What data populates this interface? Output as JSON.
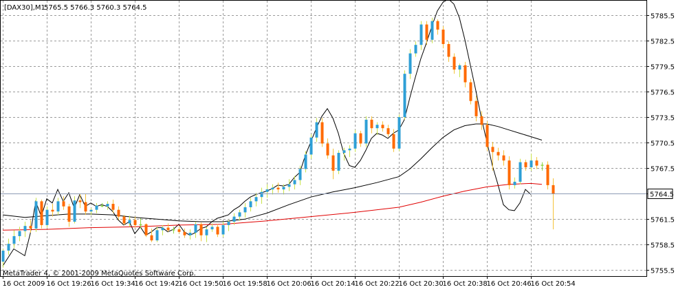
{
  "window": {
    "symbol_label": "[DAX30],M1",
    "ohlc_label": "5765.5 5766.3 5760.3 5764.5",
    "copyright": "MetaTrader 4, © 2001-2009 MetaQuotes Software Corp.",
    "current_price_label": "5764.5"
  },
  "colors": {
    "background": "#ffffff",
    "grid": "#9a9a9a",
    "bull_candle": "#2e9fd6",
    "bear_candle": "#ff6a00",
    "doji": "#8fd642",
    "wick_bull": "#c8e34a",
    "wick_bear": "#f5c23a",
    "fast_ma": "#000000",
    "slow_ma": "#000000",
    "long_ma": "#e00000",
    "price_line": "#8d9bb5"
  },
  "chart_data": {
    "type": "candlestick",
    "ylim": [
      5754.8,
      5787.2
    ],
    "y_ticks": [
      5785.5,
      5782.5,
      5779.5,
      5776.5,
      5773.5,
      5770.5,
      5767.5,
      5764.5,
      5761.5,
      5758.5,
      5755.5
    ],
    "y_tick_labels": [
      "5785.5",
      "5782.5",
      "5779.5",
      "5776.5",
      "5773.5",
      "5770.5",
      "5767.5",
      "5764.5",
      "5761.5",
      "5758.5",
      "5755.5"
    ],
    "x_tick_labels": [
      "16 Oct 2009",
      "16 Oct 19:26",
      "16 Oct 19:34",
      "16 Oct 19:42",
      "16 Oct 19:50",
      "16 Oct 19:58",
      "16 Oct 20:06",
      "16 Oct 20:14",
      "16 Oct 20:22",
      "16 Oct 20:30",
      "16 Oct 20:38",
      "16 Oct 20:46",
      "16 Oct 20:54"
    ],
    "x_tick_bars": [
      0,
      8,
      16,
      24,
      32,
      40,
      48,
      56,
      64,
      72,
      80,
      88,
      96
    ],
    "bar_count": 102,
    "current_price": 5764.5,
    "candles": [
      [
        5756.5,
        5758.0,
        5755.8,
        5757.8
      ],
      [
        5757.8,
        5759.2,
        5757.3,
        5758.6
      ],
      [
        5758.6,
        5760.2,
        5758.1,
        5759.5
      ],
      [
        5759.5,
        5760.6,
        5758.9,
        5760.1
      ],
      [
        5760.1,
        5761.2,
        5759.4,
        5760.7
      ],
      [
        5760.7,
        5761.4,
        5759.9,
        5760.4
      ],
      [
        5760.4,
        5764.0,
        5760.0,
        5763.6
      ],
      [
        5763.6,
        5763.8,
        5760.4,
        5760.8
      ],
      [
        5760.8,
        5763.0,
        5760.5,
        5762.6
      ],
      [
        5762.6,
        5763.3,
        5761.8,
        5762.4
      ],
      [
        5762.4,
        5764.0,
        5762.0,
        5763.6
      ],
      [
        5763.6,
        5764.2,
        5762.6,
        5763.0
      ],
      [
        5763.0,
        5763.3,
        5760.6,
        5761.2
      ],
      [
        5761.2,
        5764.2,
        5761.0,
        5763.7
      ],
      [
        5763.7,
        5764.5,
        5762.8,
        5763.5
      ],
      [
        5763.5,
        5764.5,
        5762.0,
        5762.4
      ],
      [
        5762.4,
        5762.8,
        5762.0,
        5762.6
      ],
      [
        5762.6,
        5763.4,
        5762.2,
        5763.1
      ],
      [
        5763.1,
        5763.4,
        5762.9,
        5763.0
      ],
      [
        5763.0,
        5763.6,
        5762.6,
        5763.3
      ],
      [
        5763.3,
        5763.8,
        5762.2,
        5762.6
      ],
      [
        5762.6,
        5763.0,
        5761.4,
        5761.8
      ],
      [
        5761.8,
        5762.0,
        5760.8,
        5761.0
      ],
      [
        5761.0,
        5761.9,
        5760.6,
        5761.4
      ],
      [
        5761.4,
        5761.8,
        5760.5,
        5760.8
      ],
      [
        5760.8,
        5761.6,
        5760.4,
        5760.9
      ],
      [
        5760.9,
        5761.0,
        5759.4,
        5759.6
      ],
      [
        5759.6,
        5760.4,
        5758.8,
        5759.0
      ],
      [
        5759.0,
        5760.6,
        5758.8,
        5760.2
      ],
      [
        5760.2,
        5760.8,
        5759.6,
        5760.5
      ],
      [
        5760.5,
        5761.0,
        5760.0,
        5760.2
      ],
      [
        5760.2,
        5760.6,
        5759.8,
        5760.3
      ],
      [
        5760.3,
        5760.6,
        5759.8,
        5760.0
      ],
      [
        5760.0,
        5760.4,
        5759.3,
        5759.6
      ],
      [
        5759.6,
        5760.3,
        5759.1,
        5759.9
      ],
      [
        5759.9,
        5761.2,
        5759.3,
        5760.9
      ],
      [
        5760.9,
        5761.1,
        5758.9,
        5759.6
      ],
      [
        5759.6,
        5760.6,
        5758.8,
        5760.3
      ],
      [
        5760.3,
        5761.0,
        5760.0,
        5760.6
      ],
      [
        5760.6,
        5760.9,
        5759.4,
        5759.7
      ],
      [
        5759.7,
        5761.2,
        5759.4,
        5760.8
      ],
      [
        5760.8,
        5761.4,
        5760.1,
        5761.2
      ],
      [
        5761.2,
        5762.2,
        5760.8,
        5761.8
      ],
      [
        5761.8,
        5762.6,
        5761.3,
        5762.3
      ],
      [
        5762.3,
        5763.4,
        5761.7,
        5762.9
      ],
      [
        5762.9,
        5764.0,
        5762.4,
        5763.6
      ],
      [
        5763.6,
        5764.6,
        5763.0,
        5764.1
      ],
      [
        5764.1,
        5765.2,
        5763.3,
        5764.7
      ],
      [
        5764.7,
        5765.6,
        5764.0,
        5765.0
      ],
      [
        5765.0,
        5765.6,
        5764.4,
        5765.2
      ],
      [
        5765.2,
        5765.8,
        5764.6,
        5765.0
      ],
      [
        5765.0,
        5765.6,
        5764.4,
        5765.3
      ],
      [
        5765.3,
        5766.2,
        5764.8,
        5765.6
      ],
      [
        5765.6,
        5766.6,
        5765.0,
        5766.1
      ],
      [
        5766.1,
        5767.8,
        5765.5,
        5767.4
      ],
      [
        5767.4,
        5769.5,
        5767.0,
        5769.1
      ],
      [
        5769.1,
        5771.5,
        5768.6,
        5771.1
      ],
      [
        5771.1,
        5773.4,
        5770.6,
        5772.9
      ],
      [
        5772.9,
        5773.4,
        5770.0,
        5770.4
      ],
      [
        5770.4,
        5771.0,
        5768.6,
        5769.0
      ],
      [
        5769.0,
        5769.8,
        5766.2,
        5767.2
      ],
      [
        5767.2,
        5769.6,
        5766.8,
        5769.3
      ],
      [
        5769.3,
        5769.9,
        5768.4,
        5769.6
      ],
      [
        5769.6,
        5770.2,
        5768.8,
        5769.8
      ],
      [
        5769.8,
        5772.0,
        5769.4,
        5771.6
      ],
      [
        5771.6,
        5771.9,
        5770.0,
        5770.4
      ],
      [
        5770.4,
        5773.6,
        5770.0,
        5773.2
      ],
      [
        5773.2,
        5773.6,
        5771.6,
        5772.2
      ],
      [
        5772.2,
        5772.9,
        5771.4,
        5772.6
      ],
      [
        5772.6,
        5773.0,
        5771.8,
        5772.2
      ],
      [
        5772.2,
        5772.6,
        5771.2,
        5771.5
      ],
      [
        5771.5,
        5772.1,
        5769.4,
        5769.8
      ],
      [
        5769.8,
        5773.8,
        5769.5,
        5773.5
      ],
      [
        5773.5,
        5779.0,
        5773.2,
        5778.6
      ],
      [
        5778.6,
        5781.5,
        5778.0,
        5781.0
      ],
      [
        5781.0,
        5782.4,
        5780.6,
        5782.0
      ],
      [
        5782.0,
        5784.8,
        5781.4,
        5784.4
      ],
      [
        5784.4,
        5784.8,
        5782.0,
        5782.6
      ],
      [
        5782.6,
        5785.2,
        5782.2,
        5784.8
      ],
      [
        5784.8,
        5785.0,
        5783.2,
        5783.8
      ],
      [
        5783.8,
        5784.2,
        5781.6,
        5782.1
      ],
      [
        5782.1,
        5782.4,
        5780.0,
        5780.6
      ],
      [
        5780.6,
        5781.0,
        5778.6,
        5779.1
      ],
      [
        5779.1,
        5779.8,
        5778.2,
        5779.6
      ],
      [
        5779.6,
        5780.0,
        5777.0,
        5777.6
      ],
      [
        5777.6,
        5778.0,
        5775.0,
        5775.4
      ],
      [
        5775.4,
        5776.0,
        5773.0,
        5773.6
      ],
      [
        5773.6,
        5774.2,
        5772.0,
        5772.6
      ],
      [
        5772.6,
        5773.0,
        5769.5,
        5770.0
      ],
      [
        5770.0,
        5770.6,
        5767.2,
        5769.4
      ],
      [
        5769.4,
        5769.9,
        5768.4,
        5769.0
      ],
      [
        5769.0,
        5769.6,
        5767.8,
        5768.4
      ],
      [
        5768.4,
        5768.9,
        5765.0,
        5765.5
      ],
      [
        5765.5,
        5766.4,
        5765.1,
        5765.9
      ],
      [
        5765.9,
        5768.6,
        5765.6,
        5768.2
      ],
      [
        5768.2,
        5768.5,
        5767.2,
        5767.6
      ],
      [
        5767.6,
        5769.2,
        5767.2,
        5768.4
      ],
      [
        5768.4,
        5768.8,
        5767.4,
        5767.8
      ],
      [
        5767.8,
        5768.2,
        5767.2,
        5767.9
      ],
      [
        5767.9,
        5768.3,
        5765.0,
        5765.5
      ],
      [
        5765.5,
        5766.3,
        5760.3,
        5764.5
      ]
    ],
    "series": [
      {
        "key": "fast_ma",
        "style": "fast_ma",
        "points": [
          [
            0,
            5756.0
          ],
          [
            2,
            5758.0
          ],
          [
            4,
            5757.2
          ],
          [
            5,
            5759.8
          ],
          [
            6,
            5763.6
          ],
          [
            7,
            5761.8
          ],
          [
            8,
            5763.9
          ],
          [
            9,
            5763.4
          ],
          [
            10,
            5765.0
          ],
          [
            11,
            5763.6
          ],
          [
            12,
            5764.6
          ],
          [
            13,
            5762.8
          ],
          [
            14,
            5764.4
          ],
          [
            15,
            5763.0
          ],
          [
            16,
            5763.4
          ],
          [
            17,
            5763.0
          ],
          [
            18,
            5763.2
          ],
          [
            19,
            5763.0
          ],
          [
            20,
            5762.4
          ],
          [
            21,
            5761.4
          ],
          [
            22,
            5760.8
          ],
          [
            23,
            5761.2
          ],
          [
            24,
            5759.8
          ],
          [
            25,
            5760.6
          ],
          [
            26,
            5759.6
          ],
          [
            27,
            5760.0
          ],
          [
            28,
            5760.5
          ],
          [
            29,
            5760.5
          ],
          [
            30,
            5760.0
          ],
          [
            31,
            5760.3
          ],
          [
            32,
            5760.9
          ],
          [
            33,
            5760.0
          ],
          [
            34,
            5759.6
          ],
          [
            35,
            5759.9
          ],
          [
            36,
            5760.4
          ],
          [
            37,
            5760.6
          ],
          [
            38,
            5761.2
          ],
          [
            39,
            5761.6
          ],
          [
            40,
            5761.8
          ],
          [
            41,
            5762.0
          ],
          [
            42,
            5762.6
          ],
          [
            43,
            5763.0
          ],
          [
            44,
            5763.6
          ],
          [
            45,
            5764.1
          ],
          [
            46,
            5764.4
          ],
          [
            47,
            5764.6
          ],
          [
            48,
            5764.8
          ],
          [
            49,
            5765.1
          ],
          [
            50,
            5765.5
          ],
          [
            51,
            5765.4
          ],
          [
            52,
            5765.6
          ],
          [
            53,
            5766.4
          ],
          [
            54,
            5767.0
          ],
          [
            55,
            5769.0
          ],
          [
            56,
            5770.6
          ],
          [
            57,
            5772.2
          ],
          [
            58,
            5773.6
          ],
          [
            59,
            5774.5
          ],
          [
            60,
            5773.4
          ],
          [
            61,
            5771.6
          ],
          [
            62,
            5769.2
          ],
          [
            63,
            5767.8
          ],
          [
            64,
            5767.6
          ],
          [
            65,
            5768.4
          ],
          [
            66,
            5769.6
          ],
          [
            67,
            5771.0
          ],
          [
            68,
            5771.6
          ],
          [
            69,
            5771.4
          ],
          [
            70,
            5771.0
          ],
          [
            71,
            5771.6
          ],
          [
            72,
            5772.0
          ],
          [
            73,
            5773.2
          ],
          [
            74,
            5775.8
          ],
          [
            75,
            5778.2
          ],
          [
            76,
            5780.4
          ],
          [
            77,
            5782.2
          ],
          [
            78,
            5784.2
          ],
          [
            79,
            5786.0
          ],
          [
            80,
            5787.0
          ],
          [
            81,
            5787.4
          ],
          [
            82,
            5786.8
          ],
          [
            83,
            5785.2
          ],
          [
            84,
            5782.6
          ],
          [
            85,
            5779.6
          ],
          [
            86,
            5776.6
          ],
          [
            87,
            5773.4
          ],
          [
            88,
            5770.6
          ],
          [
            89,
            5767.8
          ],
          [
            90,
            5765.6
          ],
          [
            91,
            5763.2
          ],
          [
            92,
            5762.6
          ],
          [
            93,
            5762.5
          ],
          [
            94,
            5763.4
          ],
          [
            95,
            5765.0
          ],
          [
            96,
            5764.4
          ]
        ]
      },
      {
        "key": "slow_ma",
        "style": "slow_ma",
        "points": [
          [
            0,
            5762.0
          ],
          [
            4,
            5761.7
          ],
          [
            8,
            5761.9
          ],
          [
            12,
            5762.1
          ],
          [
            16,
            5762.1
          ],
          [
            20,
            5762.0
          ],
          [
            24,
            5761.7
          ],
          [
            28,
            5761.5
          ],
          [
            32,
            5761.3
          ],
          [
            36,
            5761.2
          ],
          [
            40,
            5761.2
          ],
          [
            44,
            5761.5
          ],
          [
            48,
            5762.2
          ],
          [
            52,
            5763.2
          ],
          [
            56,
            5764.1
          ],
          [
            60,
            5764.7
          ],
          [
            64,
            5765.2
          ],
          [
            68,
            5765.8
          ],
          [
            72,
            5766.5
          ],
          [
            74,
            5767.4
          ],
          [
            76,
            5768.6
          ],
          [
            78,
            5769.9
          ],
          [
            80,
            5771.1
          ],
          [
            82,
            5772.0
          ],
          [
            84,
            5772.5
          ],
          [
            86,
            5772.7
          ],
          [
            88,
            5772.7
          ],
          [
            90,
            5772.4
          ],
          [
            92,
            5772.0
          ],
          [
            94,
            5771.6
          ],
          [
            96,
            5771.2
          ],
          [
            98,
            5770.8
          ]
        ]
      },
      {
        "key": "long_ma",
        "style": "long_ma",
        "points": [
          [
            0,
            5760.2
          ],
          [
            8,
            5760.3
          ],
          [
            16,
            5760.5
          ],
          [
            24,
            5760.6
          ],
          [
            32,
            5760.8
          ],
          [
            40,
            5760.9
          ],
          [
            48,
            5761.3
          ],
          [
            56,
            5761.8
          ],
          [
            64,
            5762.3
          ],
          [
            72,
            5762.9
          ],
          [
            76,
            5763.5
          ],
          [
            80,
            5764.2
          ],
          [
            84,
            5764.8
          ],
          [
            88,
            5765.3
          ],
          [
            92,
            5765.6
          ],
          [
            96,
            5765.7
          ],
          [
            98,
            5765.6
          ]
        ]
      }
    ]
  }
}
